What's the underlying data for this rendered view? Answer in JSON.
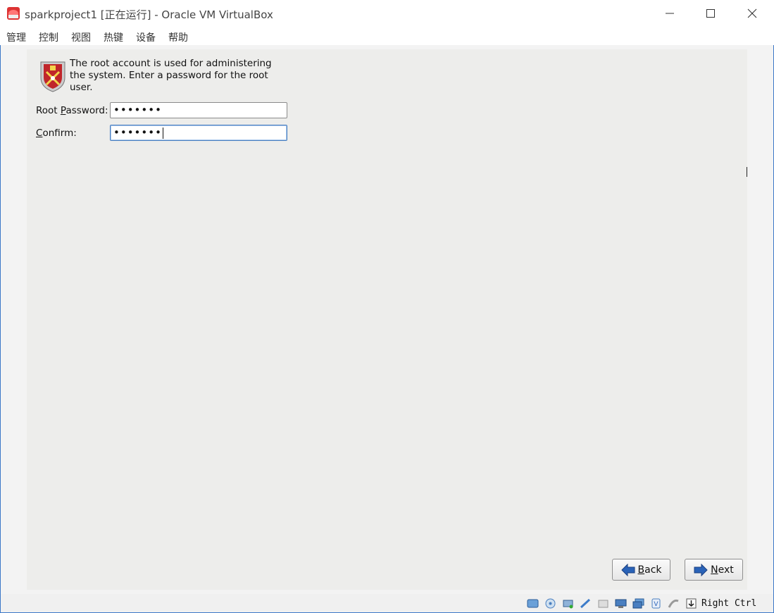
{
  "window": {
    "title": "sparkproject1 [正在运行] - Oracle VM VirtualBox",
    "app_icon": "virtualbox-icon",
    "controls": [
      "minimize-icon",
      "maximize-icon",
      "close-icon"
    ]
  },
  "menu": {
    "items": [
      "管理",
      "控制",
      "视图",
      "热键",
      "设备",
      "帮助"
    ]
  },
  "installer": {
    "icon": "shield-icon",
    "intro_line1": "The root account is used for administering",
    "intro_line2": "the system.  Enter a password for the root",
    "intro_line3": "user.",
    "root_password_label_pre": "Root ",
    "root_password_label_key": "P",
    "root_password_label_post": "assword:",
    "root_password_value": "•••••••",
    "confirm_label_key": "C",
    "confirm_label_post": "onfirm:",
    "confirm_value": "•••••••",
    "back_key": "B",
    "back_rest": "ack",
    "next_key": "N",
    "next_rest": "ext"
  },
  "statusbar": {
    "icons": [
      "hard-disk-icon",
      "optical-drive-icon",
      "audio-icon",
      "network-icon",
      "usb-icon",
      "shared-folders-icon",
      "display-icon",
      "video-capture-icon",
      "cpu-icon",
      "mouse-integration-icon",
      "keyboard-icon"
    ],
    "host_key": "Right Ctrl"
  },
  "colors": {
    "vm_background": "#ededeb",
    "focus_border": "#4a7fc0",
    "arrow_blue": "#2a63b8"
  }
}
